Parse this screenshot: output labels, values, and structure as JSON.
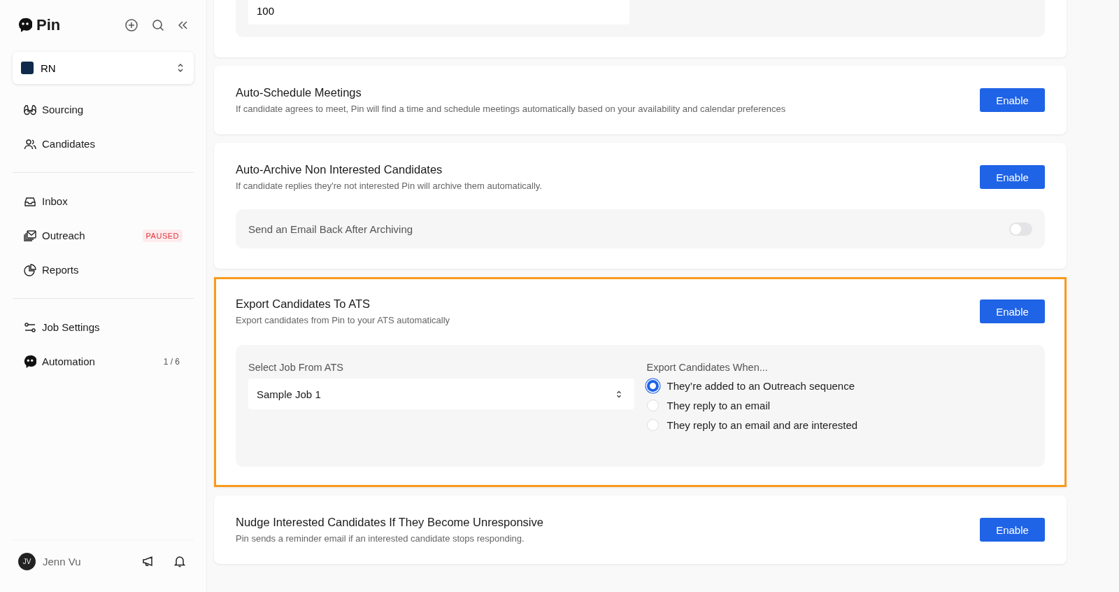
{
  "sidebar": {
    "brand": "Pin",
    "workspace": {
      "name": "RN"
    },
    "groups": [
      [
        {
          "label": "Sourcing"
        },
        {
          "label": "Candidates"
        }
      ],
      [
        {
          "label": "Inbox"
        },
        {
          "label": "Outreach",
          "tag": "PAUSED"
        },
        {
          "label": "Reports"
        }
      ],
      [
        {
          "label": "Job Settings"
        },
        {
          "label": "Automation",
          "count": "1 / 6"
        }
      ]
    ],
    "user": {
      "initials": "JV",
      "name": "Jenn Vu"
    }
  },
  "cards": [
    {
      "kind": "number",
      "value": "100",
      "highlighted": false
    },
    {
      "kind": "plain",
      "title": "Auto-Schedule Meetings",
      "description": "If candidate agrees to meet, Pin will find a time and schedule meetings automatically based on your availability and calendar preferences",
      "button": "Enable",
      "highlighted": false
    },
    {
      "kind": "toggle",
      "title": "Auto-Archive Non Interested Candidates",
      "description": "If candidate replies they're not interested Pin will archive them automatically.",
      "button": "Enable",
      "highlighted": false,
      "option": {
        "label": "Send an Email Back After Archiving",
        "on": false
      }
    },
    {
      "kind": "export",
      "title": "Export Candidates To ATS",
      "description": "Export candidates from Pin to your ATS automatically",
      "button": "Enable",
      "highlighted": true,
      "select": {
        "label": "Select Job From ATS",
        "value": "Sample Job 1"
      },
      "radios": {
        "label": "Export Candidates When...",
        "options": [
          {
            "label": "They’re added to an Outreach sequence",
            "selected": true
          },
          {
            "label": "They reply to an email",
            "selected": false
          },
          {
            "label": "They reply to an email and are interested",
            "selected": false
          }
        ]
      }
    },
    {
      "kind": "plain",
      "title": "Nudge Interested Candidates If They Become Unresponsive",
      "description": "Pin sends a reminder email if an interested candidate stops responding.",
      "button": "Enable",
      "highlighted": false
    }
  ]
}
